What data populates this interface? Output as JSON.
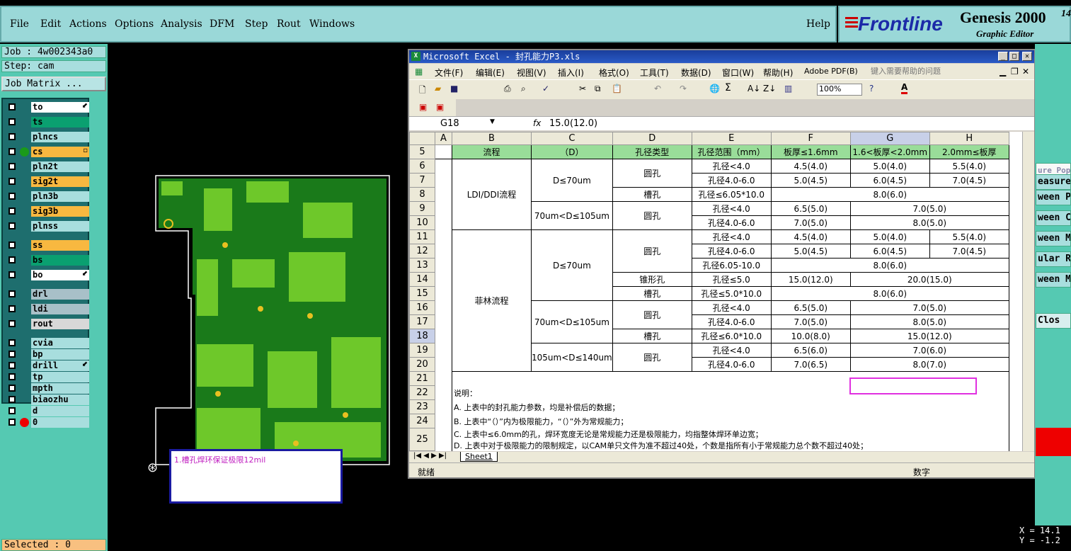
{
  "menubar": {
    "items": [
      "File",
      "Edit",
      "Actions",
      "Options",
      "Analysis",
      "DFM",
      "Step",
      "Rout",
      "Windows"
    ],
    "help": "Help"
  },
  "logo": {
    "brand": "Frontline",
    "product": "Genesis 2000",
    "version_frag": "14",
    "subtitle": "Graphic Editor"
  },
  "left": {
    "job": "Job : 4w002343a0",
    "step": "Step: cam",
    "job_matrix": "Job Matrix ...",
    "selected": "Selected : 0",
    "layers": [
      {
        "name": "to",
        "color": "#ffffff",
        "mark": "⬋"
      },
      {
        "name": "ts",
        "color": "#0aa070",
        "mark": ""
      },
      {
        "name": "plncs",
        "color": "#a8dede",
        "mark": ""
      },
      {
        "name": "cs",
        "color": "#f8b840",
        "mark": "▫"
      },
      {
        "name": "pln2t",
        "color": "#a8dede",
        "mark": ""
      },
      {
        "name": "sig2t",
        "color": "#f8b840",
        "mark": ""
      },
      {
        "name": "pln3b",
        "color": "#a8dede",
        "mark": ""
      },
      {
        "name": "sig3b",
        "color": "#f8b840",
        "mark": ""
      },
      {
        "name": "plnss",
        "color": "#a8dede",
        "mark": ""
      },
      {
        "name": "ss",
        "color": "#f8b840",
        "mark": ""
      },
      {
        "name": "bs",
        "color": "#0aa070",
        "mark": ""
      },
      {
        "name": "bo",
        "color": "#ffffff",
        "mark": "⬋"
      },
      {
        "name": "drl",
        "color": "#a8c0c8",
        "mark": ""
      },
      {
        "name": "ldi",
        "color": "#a8c0c8",
        "mark": ""
      },
      {
        "name": "rout",
        "color": "#d8d8d8",
        "mark": ""
      },
      {
        "name": "cvia",
        "color": "#a8dede",
        "mark": ""
      },
      {
        "name": "bp",
        "color": "#a8dede",
        "mark": ""
      },
      {
        "name": "drill",
        "color": "#a8dede",
        "mark": "⬋"
      },
      {
        "name": "tp",
        "color": "#a8dede",
        "mark": ""
      },
      {
        "name": "mpth",
        "color": "#a8dede",
        "mark": ""
      },
      {
        "name": "biaozhu",
        "color": "#a8dede",
        "mark": ""
      },
      {
        "name": "d",
        "color": "#a8dede",
        "mark": ""
      },
      {
        "name": "0",
        "color": "#a8dede",
        "mark": ""
      }
    ]
  },
  "excel": {
    "title": "Microsoft Excel - 封孔能力P3.xls",
    "menu": [
      "文件(F)",
      "编辑(E)",
      "视图(V)",
      "插入(I)",
      "格式(O)",
      "工具(T)",
      "数据(D)",
      "窗口(W)",
      "帮助(H)",
      "Adobe PDF(B)"
    ],
    "help_placeholder": "键入需要帮助的问题",
    "zoom": "100%",
    "name_box": "G18",
    "fx": "fx",
    "formula": "15.0(12.0)",
    "columns": [
      "A",
      "B",
      "C",
      "D",
      "E",
      "F",
      "G",
      "H"
    ],
    "row5": [
      "流程",
      "（D）",
      "孔径类型",
      "孔径范围（mm）",
      "板厚≤1.6mm",
      "1.6<板厚<2.0mm",
      "2.0mm≤板厚"
    ],
    "group1": "LDI/DDI流程",
    "group2": "菲林流程",
    "d1": "D≤70um",
    "d2": "70um<D≤105um",
    "d3": "105um<D≤140um",
    "round": "圆孔",
    "slot": "槽孔",
    "cone": "锥形孔",
    "r6": [
      "孔径<4.0",
      "4.5(4.0)",
      "5.0(4.0)",
      "5.5(4.0)"
    ],
    "r7": [
      "孔径4.0-6.0",
      "5.0(4.5)",
      "6.0(4.5)",
      "7.0(4.5)"
    ],
    "r8": [
      "孔径≤6.05*10.0",
      "8.0(6.0)"
    ],
    "r9": [
      "孔径<4.0",
      "6.5(5.0)",
      "7.0(5.0)"
    ],
    "r10": [
      "孔径4.0-6.0",
      "7.0(5.0)",
      "8.0(5.0)"
    ],
    "r11": [
      "孔径<4.0",
      "4.5(4.0)",
      "5.0(4.0)",
      "5.5(4.0)"
    ],
    "r12": [
      "孔径4.0-6.0",
      "5.0(4.5)",
      "6.0(4.5)",
      "7.0(4.5)"
    ],
    "r13": [
      "孔径6.05-10.0",
      "8.0(6.0)"
    ],
    "r14": [
      "孔径≤5.0",
      "15.0(12.0)",
      "20.0(15.0)"
    ],
    "r15": [
      "孔径≤5.0*10.0",
      "8.0(6.0)"
    ],
    "r16": [
      "孔径<4.0",
      "6.5(5.0)",
      "7.0(5.0)"
    ],
    "r17": [
      "孔径4.0-6.0",
      "7.0(5.0)",
      "8.0(5.0)"
    ],
    "r18": [
      "孔径≤6.0*10.0",
      "10.0(8.0)",
      "15.0(12.0)"
    ],
    "r19": [
      "孔径<4.0",
      "6.5(6.0)",
      "7.0(6.0)"
    ],
    "r20": [
      "孔径4.0-6.0",
      "7.0(6.5)",
      "8.0(7.0)"
    ],
    "notes": [
      "说明：",
      "A. 上表中的封孔能力参数，均是补偿后的数据；",
      "B. 上表中“（）”内为极限能力，“（）”外为常规能力；",
      "C. 上表中≤6.0mm的孔，焊环宽度无论是常规能力还是极限能力，均指整体焊环单边宽；",
      "D. 上表中对于极限能力的限制规定，以CAM单只文件为准不超过40处，个数是指所有小于常规能力总个数不超过40处；"
    ],
    "row_numbers": [
      "5",
      "6",
      "7",
      "8",
      "9",
      "10",
      "11",
      "12",
      "13",
      "14",
      "15",
      "16",
      "17",
      "18",
      "19",
      "20",
      "21",
      "22",
      "23",
      "24",
      "25"
    ],
    "sheet_tab": "Sheet1",
    "status_left": "就绪",
    "status_right": "数字"
  },
  "note": "1.槽孔焊环保证极限12mil",
  "right": {
    "items": [
      "ure Popu",
      "easure",
      "ween P",
      "ween C",
      "ween M",
      "ular R",
      "ween M",
      "Clos"
    ],
    "x": "X = 14.1",
    "y": "Y = -1.2"
  }
}
